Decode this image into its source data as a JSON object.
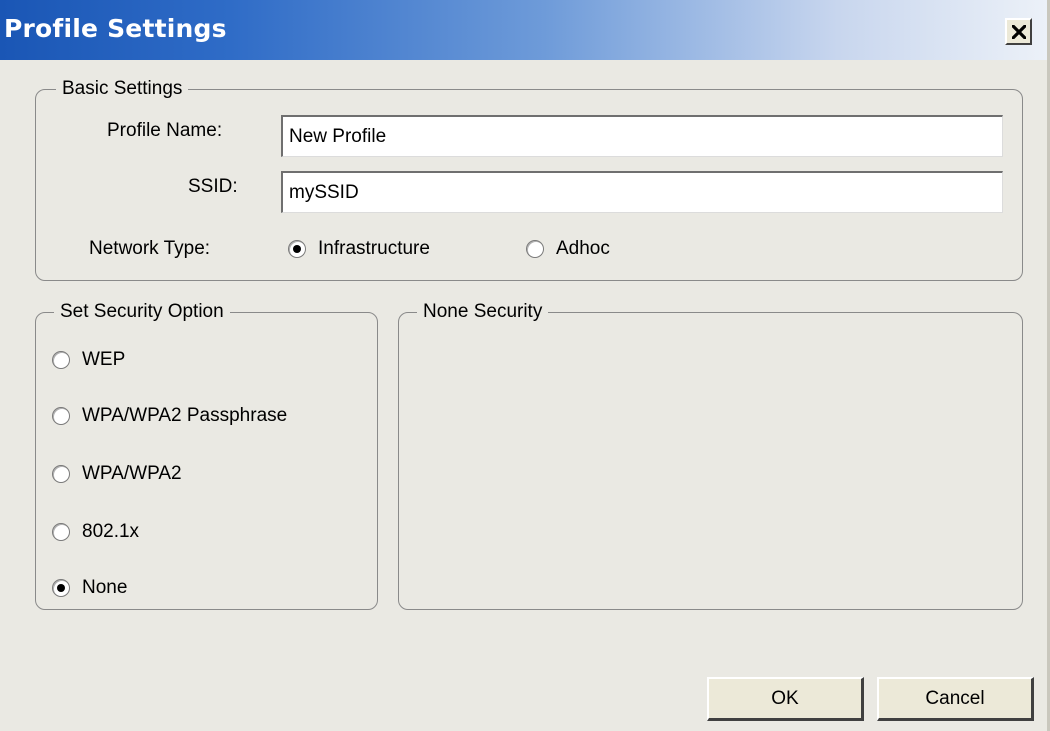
{
  "window": {
    "title": "Profile Settings",
    "close_icon": "close-icon"
  },
  "basic_settings": {
    "legend": "Basic Settings",
    "profile_name": {
      "label": "Profile Name:",
      "value": "New Profile"
    },
    "ssid": {
      "label": "SSID:",
      "value": "mySSID"
    },
    "network_type": {
      "label": "Network Type:",
      "options": [
        "Infrastructure",
        "Adhoc"
      ],
      "selected": "Infrastructure"
    }
  },
  "security_option": {
    "legend": "Set Security Option",
    "options": [
      "WEP",
      "WPA/WPA2 Passphrase",
      "WPA/WPA2",
      "802.1x",
      "None"
    ],
    "selected": "None"
  },
  "security_detail": {
    "legend": "None Security"
  },
  "buttons": {
    "ok": "OK",
    "cancel": "Cancel"
  }
}
